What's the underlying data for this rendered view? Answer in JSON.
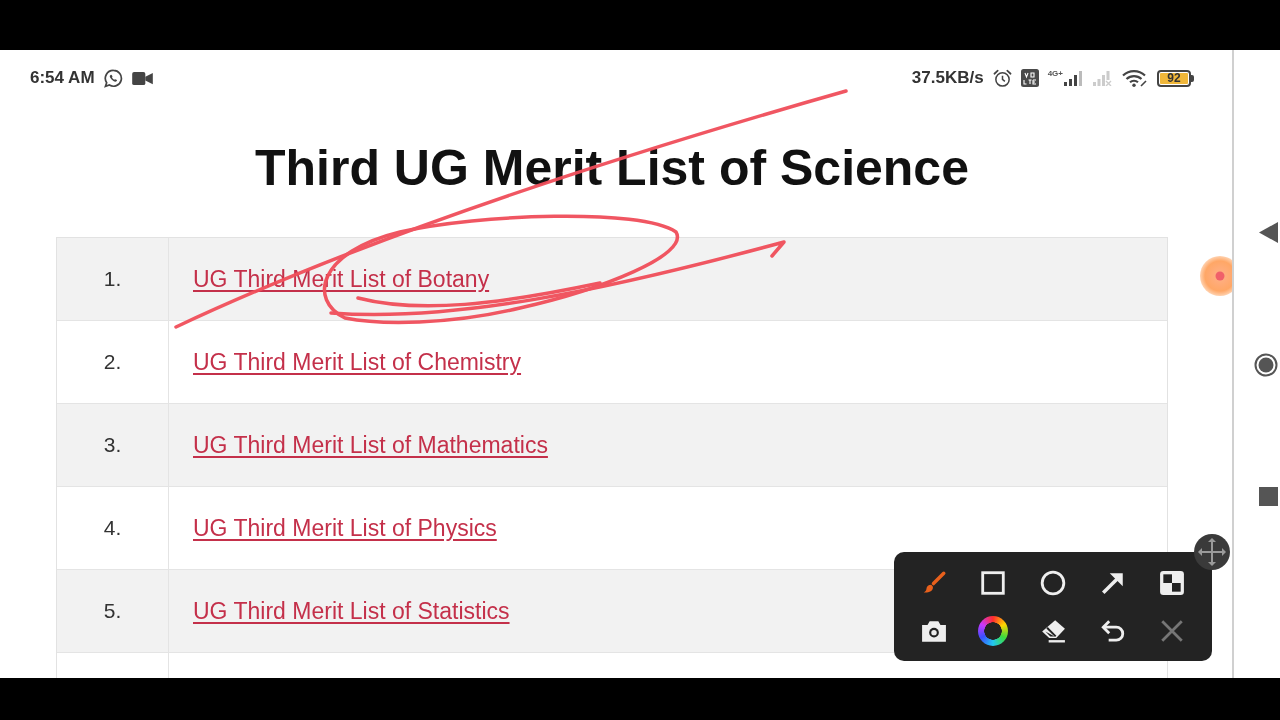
{
  "status_bar": {
    "time": "6:54 AM",
    "speed": "37.5KB/s",
    "network": "4G+",
    "battery": "92"
  },
  "page": {
    "title": "Third UG Merit List of Science",
    "rows": [
      {
        "number": "1.",
        "link": "UG Third Merit List of Botany"
      },
      {
        "number": "2.",
        "link": "UG Third Merit List of Chemistry"
      },
      {
        "number": "3.",
        "link": "UG Third Merit List of Mathematics"
      },
      {
        "number": "4.",
        "link": "UG Third Merit List of Physics"
      },
      {
        "number": "5.",
        "link": "UG Third Merit List of Statistics"
      }
    ]
  },
  "annotation_toolbar": {
    "tools": [
      {
        "kind": "brush",
        "selected": true,
        "disabled": false
      },
      {
        "kind": "rectangle",
        "selected": false,
        "disabled": false
      },
      {
        "kind": "ellipse",
        "selected": false,
        "disabled": false
      },
      {
        "kind": "arrow",
        "selected": false,
        "disabled": false
      },
      {
        "kind": "mosaic",
        "selected": false,
        "disabled": false
      },
      {
        "kind": "screenshot",
        "selected": false,
        "disabled": false
      },
      {
        "kind": "color",
        "selected": false,
        "disabled": false
      },
      {
        "kind": "eraser",
        "selected": false,
        "disabled": false
      },
      {
        "kind": "undo",
        "selected": false,
        "disabled": false
      },
      {
        "kind": "close",
        "selected": false,
        "disabled": true
      }
    ]
  }
}
